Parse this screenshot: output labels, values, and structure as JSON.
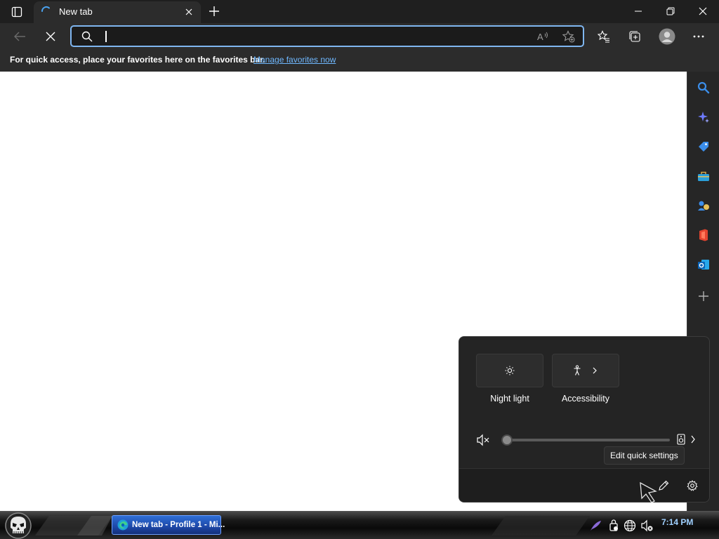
{
  "browser": {
    "tab": {
      "title": "New tab"
    },
    "address": {
      "value": "",
      "placeholder": ""
    },
    "favorites_bar": {
      "message": "For quick access, place your favorites here on the favorites bar.",
      "link": "Manage favorites now"
    }
  },
  "quick_settings": {
    "tiles": [
      {
        "label": "Night light",
        "icon": "night-light-icon"
      },
      {
        "label": "Accessibility",
        "icon": "accessibility-icon"
      }
    ],
    "volume": {
      "level": 0,
      "muted": true
    },
    "tooltip": "Edit quick settings"
  },
  "taskbar": {
    "window_label": "New tab - Profile 1 - Mi...",
    "clock": "7:14 PM"
  },
  "colors": {
    "address_border": "#7fb6f0",
    "link": "#6fb8ff",
    "taskbar_button": "#2f6fd6"
  }
}
